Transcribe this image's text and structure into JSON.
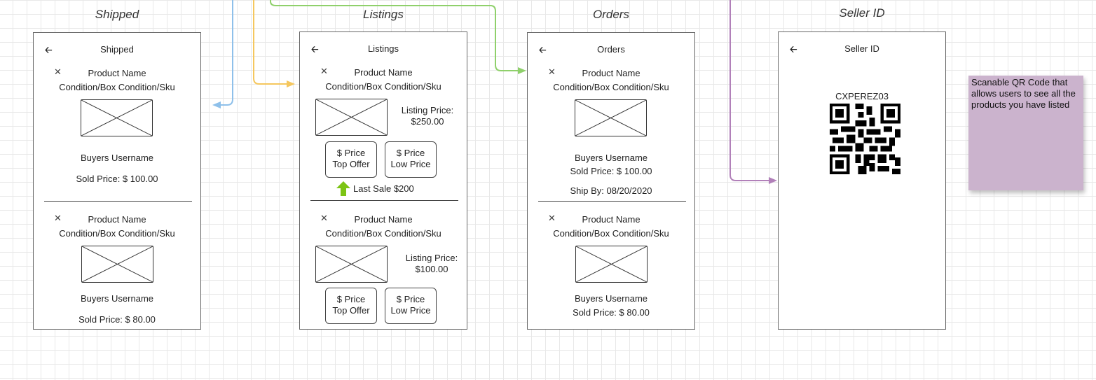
{
  "colors": {
    "blue": "#8ec0ea",
    "yellow": "#f5c75e",
    "green": "#8fd06b",
    "purple": "#b180b9",
    "note": "#cbb3cd"
  },
  "shipped": {
    "heading": "Shipped",
    "title": "Shipped",
    "items": [
      {
        "name": "Product Name",
        "condition": "Condition/Box Condition/Sku",
        "buyer": "Buyers Username",
        "sold": "Sold Price: $ 100.00"
      },
      {
        "name": "Product Name",
        "condition": "Condition/Box Condition/Sku",
        "buyer": "Buyers Username",
        "sold": "Sold Price: $ 80.00"
      }
    ]
  },
  "listings": {
    "heading": "Listings",
    "title": "Listings",
    "items": [
      {
        "name": "Product Name",
        "condition": "Condition/Box Condition/Sku",
        "price_label": "Listing Price:",
        "price": "$250.00",
        "top_offer_1": "$ Price",
        "top_offer_2": "Top Offer",
        "low_price_1": "$ Price",
        "low_price_2": "Low Price"
      },
      {
        "name": "Product Name",
        "condition": "Condition/Box Condition/Sku",
        "price_label": "Listing Price:",
        "price": "$100.00",
        "top_offer_1": "$ Price",
        "top_offer_2": "Top Offer",
        "low_price_1": "$ Price",
        "low_price_2": "Low Price"
      }
    ],
    "last_sale": "Last Sale $200"
  },
  "orders": {
    "heading": "Orders",
    "title": "Orders",
    "items": [
      {
        "name": "Product Name",
        "condition": "Condition/Box Condition/Sku",
        "buyer": "Buyers Username",
        "sold": "Sold Price: $ 100.00",
        "ship_by": "Ship By: 08/20/2020"
      },
      {
        "name": "Product Name",
        "condition": "Condition/Box Condition/Sku",
        "buyer": "Buyers Username",
        "sold": "Sold Price: $ 80.00"
      }
    ]
  },
  "seller": {
    "heading": "Seller ID",
    "title": "Seller ID",
    "id": "CXPEREZ03"
  },
  "note": {
    "text": "Scanable QR Code that allows users to see all the products you have listed"
  },
  "icons": {
    "back": "arrow-left-icon",
    "remove": "close-icon",
    "trend": "arrow-up-icon",
    "qr": "qr-code-icon",
    "image": "image-placeholder-icon"
  }
}
